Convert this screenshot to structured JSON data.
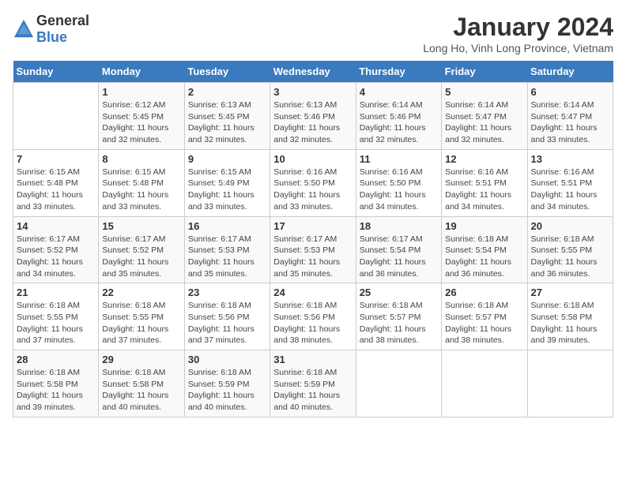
{
  "header": {
    "logo_general": "General",
    "logo_blue": "Blue",
    "title": "January 2024",
    "subtitle": "Long Ho, Vinh Long Province, Vietnam"
  },
  "days_of_week": [
    "Sunday",
    "Monday",
    "Tuesday",
    "Wednesday",
    "Thursday",
    "Friday",
    "Saturday"
  ],
  "weeks": [
    [
      {
        "day": "",
        "sunrise": "",
        "sunset": "",
        "daylight": ""
      },
      {
        "day": "1",
        "sunrise": "Sunrise: 6:12 AM",
        "sunset": "Sunset: 5:45 PM",
        "daylight": "Daylight: 11 hours and 32 minutes."
      },
      {
        "day": "2",
        "sunrise": "Sunrise: 6:13 AM",
        "sunset": "Sunset: 5:45 PM",
        "daylight": "Daylight: 11 hours and 32 minutes."
      },
      {
        "day": "3",
        "sunrise": "Sunrise: 6:13 AM",
        "sunset": "Sunset: 5:46 PM",
        "daylight": "Daylight: 11 hours and 32 minutes."
      },
      {
        "day": "4",
        "sunrise": "Sunrise: 6:14 AM",
        "sunset": "Sunset: 5:46 PM",
        "daylight": "Daylight: 11 hours and 32 minutes."
      },
      {
        "day": "5",
        "sunrise": "Sunrise: 6:14 AM",
        "sunset": "Sunset: 5:47 PM",
        "daylight": "Daylight: 11 hours and 32 minutes."
      },
      {
        "day": "6",
        "sunrise": "Sunrise: 6:14 AM",
        "sunset": "Sunset: 5:47 PM",
        "daylight": "Daylight: 11 hours and 33 minutes."
      }
    ],
    [
      {
        "day": "7",
        "sunrise": "Sunrise: 6:15 AM",
        "sunset": "Sunset: 5:48 PM",
        "daylight": "Daylight: 11 hours and 33 minutes."
      },
      {
        "day": "8",
        "sunrise": "Sunrise: 6:15 AM",
        "sunset": "Sunset: 5:48 PM",
        "daylight": "Daylight: 11 hours and 33 minutes."
      },
      {
        "day": "9",
        "sunrise": "Sunrise: 6:15 AM",
        "sunset": "Sunset: 5:49 PM",
        "daylight": "Daylight: 11 hours and 33 minutes."
      },
      {
        "day": "10",
        "sunrise": "Sunrise: 6:16 AM",
        "sunset": "Sunset: 5:50 PM",
        "daylight": "Daylight: 11 hours and 33 minutes."
      },
      {
        "day": "11",
        "sunrise": "Sunrise: 6:16 AM",
        "sunset": "Sunset: 5:50 PM",
        "daylight": "Daylight: 11 hours and 34 minutes."
      },
      {
        "day": "12",
        "sunrise": "Sunrise: 6:16 AM",
        "sunset": "Sunset: 5:51 PM",
        "daylight": "Daylight: 11 hours and 34 minutes."
      },
      {
        "day": "13",
        "sunrise": "Sunrise: 6:16 AM",
        "sunset": "Sunset: 5:51 PM",
        "daylight": "Daylight: 11 hours and 34 minutes."
      }
    ],
    [
      {
        "day": "14",
        "sunrise": "Sunrise: 6:17 AM",
        "sunset": "Sunset: 5:52 PM",
        "daylight": "Daylight: 11 hours and 34 minutes."
      },
      {
        "day": "15",
        "sunrise": "Sunrise: 6:17 AM",
        "sunset": "Sunset: 5:52 PM",
        "daylight": "Daylight: 11 hours and 35 minutes."
      },
      {
        "day": "16",
        "sunrise": "Sunrise: 6:17 AM",
        "sunset": "Sunset: 5:53 PM",
        "daylight": "Daylight: 11 hours and 35 minutes."
      },
      {
        "day": "17",
        "sunrise": "Sunrise: 6:17 AM",
        "sunset": "Sunset: 5:53 PM",
        "daylight": "Daylight: 11 hours and 35 minutes."
      },
      {
        "day": "18",
        "sunrise": "Sunrise: 6:17 AM",
        "sunset": "Sunset: 5:54 PM",
        "daylight": "Daylight: 11 hours and 36 minutes."
      },
      {
        "day": "19",
        "sunrise": "Sunrise: 6:18 AM",
        "sunset": "Sunset: 5:54 PM",
        "daylight": "Daylight: 11 hours and 36 minutes."
      },
      {
        "day": "20",
        "sunrise": "Sunrise: 6:18 AM",
        "sunset": "Sunset: 5:55 PM",
        "daylight": "Daylight: 11 hours and 36 minutes."
      }
    ],
    [
      {
        "day": "21",
        "sunrise": "Sunrise: 6:18 AM",
        "sunset": "Sunset: 5:55 PM",
        "daylight": "Daylight: 11 hours and 37 minutes."
      },
      {
        "day": "22",
        "sunrise": "Sunrise: 6:18 AM",
        "sunset": "Sunset: 5:55 PM",
        "daylight": "Daylight: 11 hours and 37 minutes."
      },
      {
        "day": "23",
        "sunrise": "Sunrise: 6:18 AM",
        "sunset": "Sunset: 5:56 PM",
        "daylight": "Daylight: 11 hours and 37 minutes."
      },
      {
        "day": "24",
        "sunrise": "Sunrise: 6:18 AM",
        "sunset": "Sunset: 5:56 PM",
        "daylight": "Daylight: 11 hours and 38 minutes."
      },
      {
        "day": "25",
        "sunrise": "Sunrise: 6:18 AM",
        "sunset": "Sunset: 5:57 PM",
        "daylight": "Daylight: 11 hours and 38 minutes."
      },
      {
        "day": "26",
        "sunrise": "Sunrise: 6:18 AM",
        "sunset": "Sunset: 5:57 PM",
        "daylight": "Daylight: 11 hours and 38 minutes."
      },
      {
        "day": "27",
        "sunrise": "Sunrise: 6:18 AM",
        "sunset": "Sunset: 5:58 PM",
        "daylight": "Daylight: 11 hours and 39 minutes."
      }
    ],
    [
      {
        "day": "28",
        "sunrise": "Sunrise: 6:18 AM",
        "sunset": "Sunset: 5:58 PM",
        "daylight": "Daylight: 11 hours and 39 minutes."
      },
      {
        "day": "29",
        "sunrise": "Sunrise: 6:18 AM",
        "sunset": "Sunset: 5:58 PM",
        "daylight": "Daylight: 11 hours and 40 minutes."
      },
      {
        "day": "30",
        "sunrise": "Sunrise: 6:18 AM",
        "sunset": "Sunset: 5:59 PM",
        "daylight": "Daylight: 11 hours and 40 minutes."
      },
      {
        "day": "31",
        "sunrise": "Sunrise: 6:18 AM",
        "sunset": "Sunset: 5:59 PM",
        "daylight": "Daylight: 11 hours and 40 minutes."
      },
      {
        "day": "",
        "sunrise": "",
        "sunset": "",
        "daylight": ""
      },
      {
        "day": "",
        "sunrise": "",
        "sunset": "",
        "daylight": ""
      },
      {
        "day": "",
        "sunrise": "",
        "sunset": "",
        "daylight": ""
      }
    ]
  ]
}
